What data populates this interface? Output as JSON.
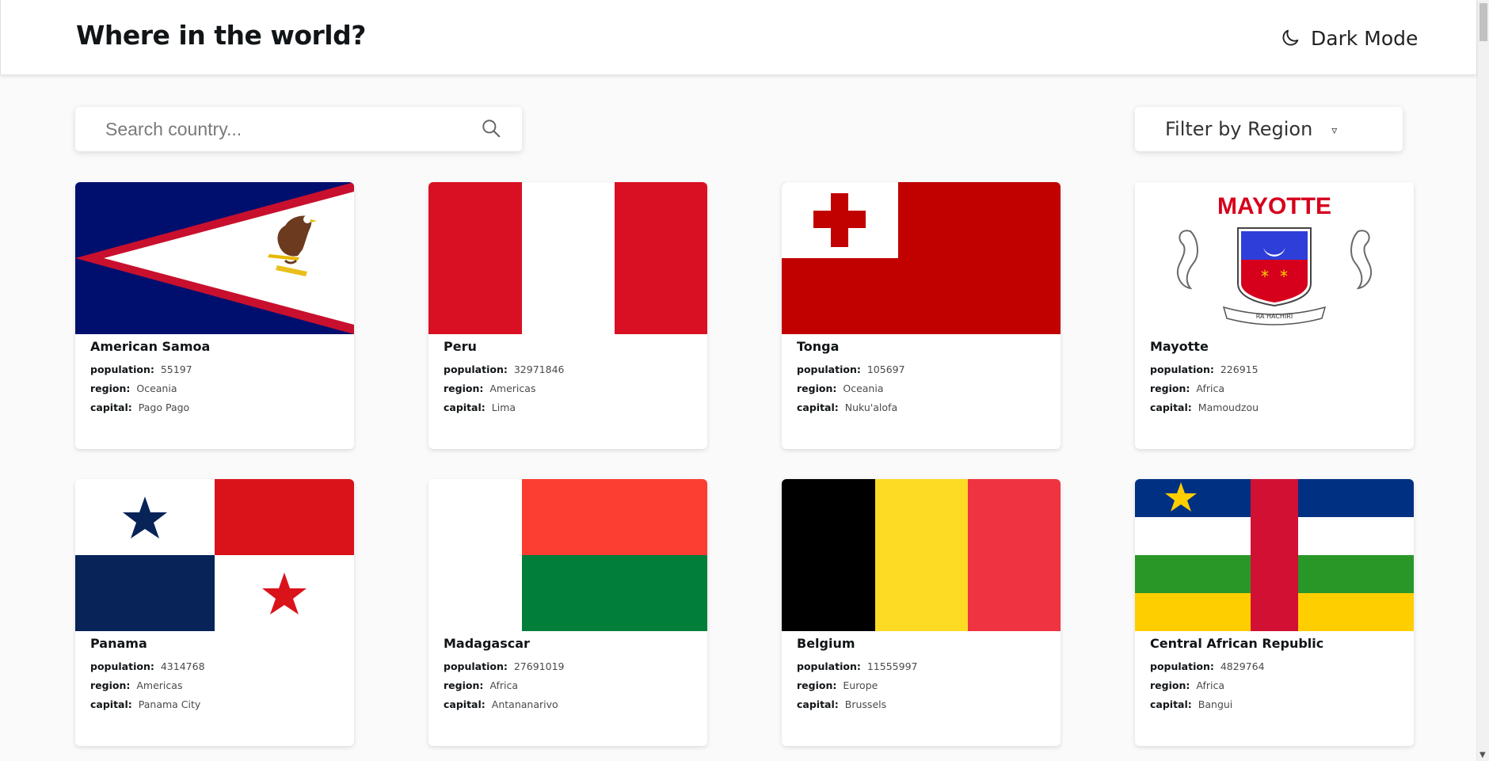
{
  "header": {
    "title": "Where in the world?",
    "theme_toggle_label": "Dark Mode",
    "theme_icon": "moon-icon"
  },
  "search": {
    "placeholder": "Search country...",
    "value": "",
    "icon": "search-icon"
  },
  "filter": {
    "label": "Filter by Region",
    "icon": "caret-down-icon"
  },
  "labels": {
    "population": "population:",
    "region": "region:",
    "capital": "capital:"
  },
  "countries": [
    {
      "name": "American Samoa",
      "population": "55197",
      "region": "Oceania",
      "capital": "Pago Pago",
      "flag": "american-samoa-flag"
    },
    {
      "name": "Peru",
      "population": "32971846",
      "region": "Americas",
      "capital": "Lima",
      "flag": "peru-flag"
    },
    {
      "name": "Tonga",
      "population": "105697",
      "region": "Oceania",
      "capital": "Nuku'alofa",
      "flag": "tonga-flag"
    },
    {
      "name": "Mayotte",
      "population": "226915",
      "region": "Africa",
      "capital": "Mamoudzou",
      "flag": "mayotte-flag"
    },
    {
      "name": "Panama",
      "population": "4314768",
      "region": "Americas",
      "capital": "Panama City",
      "flag": "panama-flag"
    },
    {
      "name": "Madagascar",
      "population": "27691019",
      "region": "Africa",
      "capital": "Antananarivo",
      "flag": "madagascar-flag"
    },
    {
      "name": "Belgium",
      "population": "11555997",
      "region": "Europe",
      "capital": "Brussels",
      "flag": "belgium-flag"
    },
    {
      "name": "Central African Republic",
      "population": "4829764",
      "region": "Africa",
      "capital": "Bangui",
      "flag": "central-african-republic-flag"
    }
  ],
  "mayotte_flag_text": "MAYOTTE",
  "mayotte_flag_motto": "RA HACHIRI",
  "colors": {
    "background": "#fafafa",
    "card": "#ffffff",
    "text": "#111517"
  }
}
